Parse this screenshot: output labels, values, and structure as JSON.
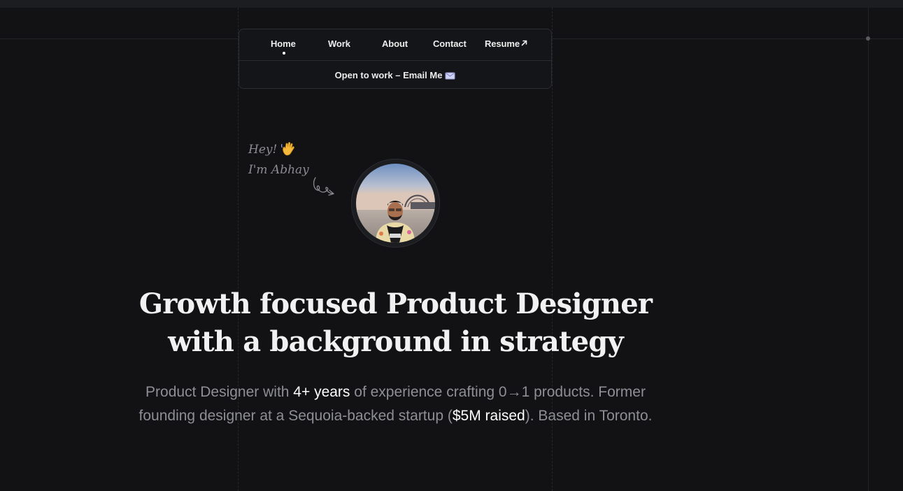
{
  "nav": {
    "items": [
      {
        "label": "Home",
        "active": true
      },
      {
        "label": "Work"
      },
      {
        "label": "About"
      },
      {
        "label": "Contact"
      },
      {
        "label": "Resume"
      }
    ],
    "resume_icon": "arrow-up-right-icon"
  },
  "banner": {
    "text": "Open to work – Email Me",
    "icon": "envelope-icon"
  },
  "intro": {
    "line1": "Hey!",
    "line2": "I'm Abhay",
    "wave_icon": "waving-hand-icon"
  },
  "headline": {
    "line1": "Growth focused Product Designer",
    "line2": "with a background in strategy"
  },
  "subtitle": {
    "part1": "Product Designer with ",
    "years": "4+ years",
    "part2": " of experience crafting 0→1 products. Former",
    "part3": "founding designer at a Sequoia-backed startup (",
    "raised": "$5M raised",
    "part4": ").  Based in Toronto."
  },
  "colors": {
    "background": "#121215",
    "text_primary": "#f1f1f1",
    "text_muted": "#8e8f94"
  }
}
